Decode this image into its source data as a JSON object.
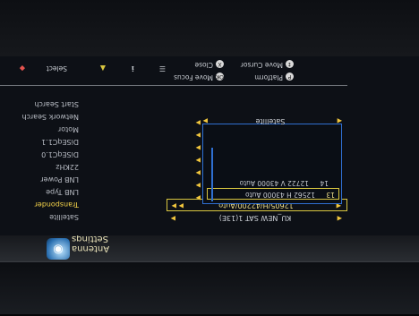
{
  "title": "Antenna Settings",
  "menu": [
    {
      "label": "Satellite",
      "selected": false
    },
    {
      "label": "Transponder",
      "selected": true
    },
    {
      "label": "LNB Type",
      "selected": false
    },
    {
      "label": "LNB Power",
      "selected": false
    },
    {
      "label": "22KHz",
      "selected": false
    },
    {
      "label": "DiSEqC1.0",
      "selected": false
    },
    {
      "label": "DiSEqC1.1",
      "selected": false
    },
    {
      "label": "Motor",
      "selected": false
    },
    {
      "label": "Network Search",
      "selected": false
    },
    {
      "label": "Start Search",
      "selected": false
    }
  ],
  "fields": {
    "satellite": "KU_NEW SAT 1(13E)",
    "transponder": "12605/H/42200/Auto"
  },
  "transponder_list": [
    {
      "index": "13",
      "info": "12562 H 43000 Auto"
    },
    {
      "index": "14",
      "info": "12722 V 43000 Auto"
    }
  ],
  "search_mode": "Satellite",
  "legend": [
    {
      "key": "Select",
      "icon": "color-key-icon"
    },
    {
      "key": "Move Focus",
      "icon": "ok-icon"
    },
    {
      "key": "Move Cursor",
      "icon": "arrow-key-icon"
    },
    {
      "key": "Close",
      "icon": "exit-icon"
    },
    {
      "key": "Platform",
      "icon": "platform-icon"
    }
  ]
}
